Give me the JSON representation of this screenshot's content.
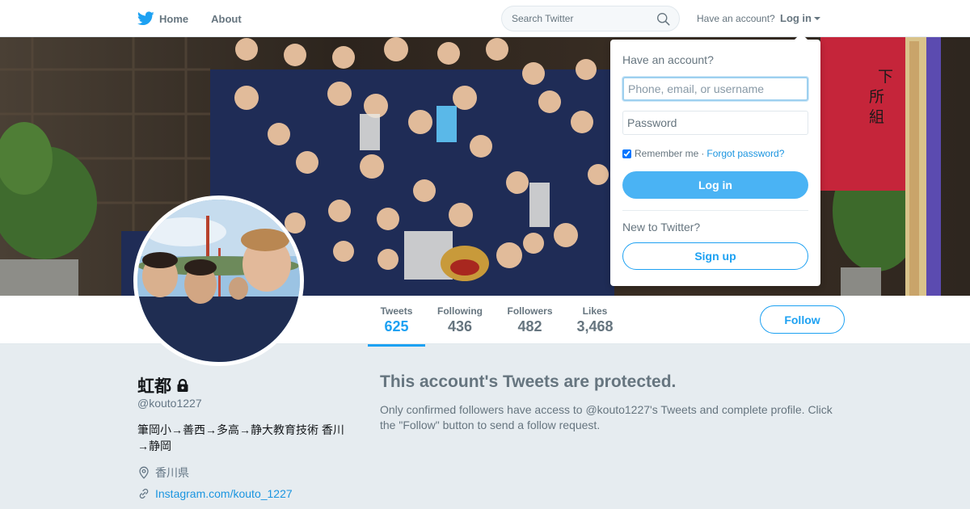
{
  "nav": {
    "home_label": "Home",
    "about_label": "About",
    "search_placeholder": "Search Twitter",
    "have_account": "Have an account?",
    "login_label": "Log in"
  },
  "login_dropdown": {
    "question": "Have an account?",
    "username_placeholder": "Phone, email, or username",
    "password_placeholder": "Password",
    "remember_label": "Remember me",
    "separator": "·",
    "forgot_label": "Forgot password?",
    "remember_checked": true,
    "login_button": "Log in",
    "new_question": "New to Twitter?",
    "signup_button": "Sign up"
  },
  "stats": [
    {
      "label": "Tweets",
      "value": "625",
      "active": true
    },
    {
      "label": "Following",
      "value": "436",
      "active": false
    },
    {
      "label": "Followers",
      "value": "482",
      "active": false
    },
    {
      "label": "Likes",
      "value": "3,468",
      "active": false
    }
  ],
  "follow_button": "Follow",
  "profile": {
    "name": "虹都",
    "handle": "@kouto1227",
    "bio": "筆岡小→善西→多高→静大教育技術 香川→静岡",
    "location": "香川県",
    "url": "Instagram.com/kouto_1227",
    "protected": true
  },
  "protected_notice": {
    "title": "This account's Tweets are protected.",
    "text": "Only confirmed followers have access to @kouto1227's Tweets and complete profile. Click the \"Follow\" button to send a follow request."
  },
  "banner_sign_text": "下所組",
  "colors": {
    "accent": "#1da1f2",
    "login_button": "#4ab3f4",
    "secondary_text": "#66757f",
    "link": "#1b95e0",
    "page_bg": "#e6ecf0"
  },
  "icons": [
    "twitter-bird-icon",
    "search-icon",
    "caret-down-icon",
    "lock-icon",
    "location-pin-icon",
    "link-icon"
  ]
}
